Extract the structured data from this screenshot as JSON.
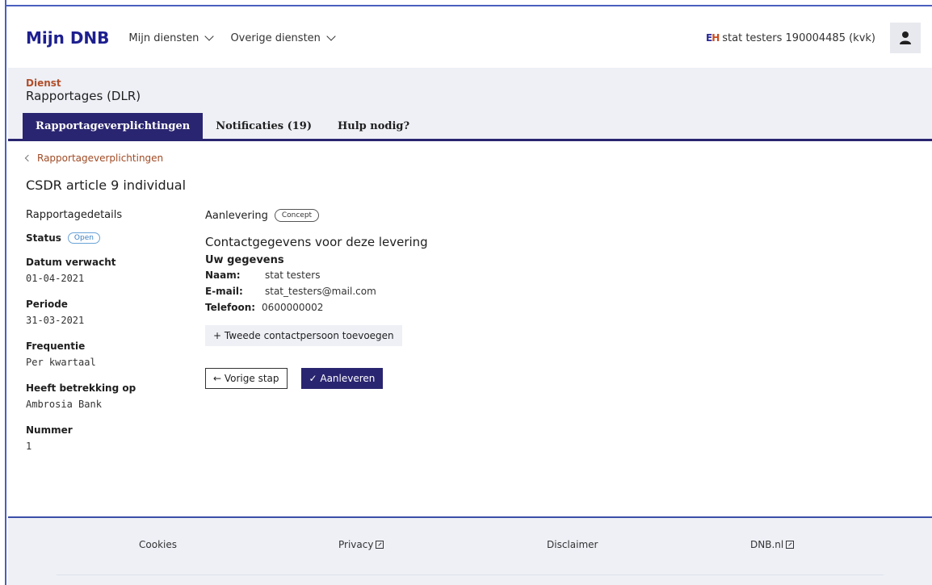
{
  "header": {
    "brand": "Mijn DNB",
    "nav": [
      {
        "label": "Mijn diensten"
      },
      {
        "label": "Overige diensten"
      }
    ],
    "org_badge": "EH",
    "org_label": "stat testers 190004485 (kvk)"
  },
  "service": {
    "kicker": "Dienst",
    "title": "Rapportages (DLR)",
    "tabs": [
      {
        "label": "Rapportageverplichtingen",
        "active": true
      },
      {
        "label": "Notificaties (19)",
        "active": false
      },
      {
        "label": "Hulp nodig?",
        "active": false
      }
    ]
  },
  "main": {
    "breadcrumb": "Rapportageverplichtingen",
    "title": "CSDR article 9 individual",
    "details": {
      "heading": "Rapportagedetails",
      "status_label": "Status",
      "status_value": "Open",
      "items": [
        {
          "label": "Datum verwacht",
          "value": "01-04-2021"
        },
        {
          "label": "Periode",
          "value": "31-03-2021"
        },
        {
          "label": "Frequentie",
          "value": "Per kwartaal"
        },
        {
          "label": "Heeft betrekking op",
          "value": "Ambrosia Bank"
        },
        {
          "label": "Nummer",
          "value": "1"
        }
      ]
    },
    "submission": {
      "heading": "Aanlevering",
      "badge": "Concept",
      "contact_title": "Contactgegevens voor deze levering",
      "your_data": "Uw gegevens",
      "name_label": "Naam:",
      "name_value": "stat testers",
      "email_label": "E-mail:",
      "email_value": "stat_testers@mail.com",
      "phone_label": "Telefoon:",
      "phone_value": "0600000002",
      "add_contact": "+ Tweede contactpersoon toevoegen",
      "prev_button": "← Vorige stap",
      "submit_button": "✓ Aanleveren"
    }
  },
  "footer": {
    "links": [
      {
        "label": "Cookies",
        "external": false
      },
      {
        "label": "Privacy",
        "external": true
      },
      {
        "label": "Disclaimer",
        "external": false
      },
      {
        "label": "DNB.nl",
        "external": true
      }
    ]
  },
  "colors": {
    "brand": "#1d1f8f",
    "primary": "#2a2570",
    "accent": "#b04f2a",
    "band": "#eef0f6"
  }
}
